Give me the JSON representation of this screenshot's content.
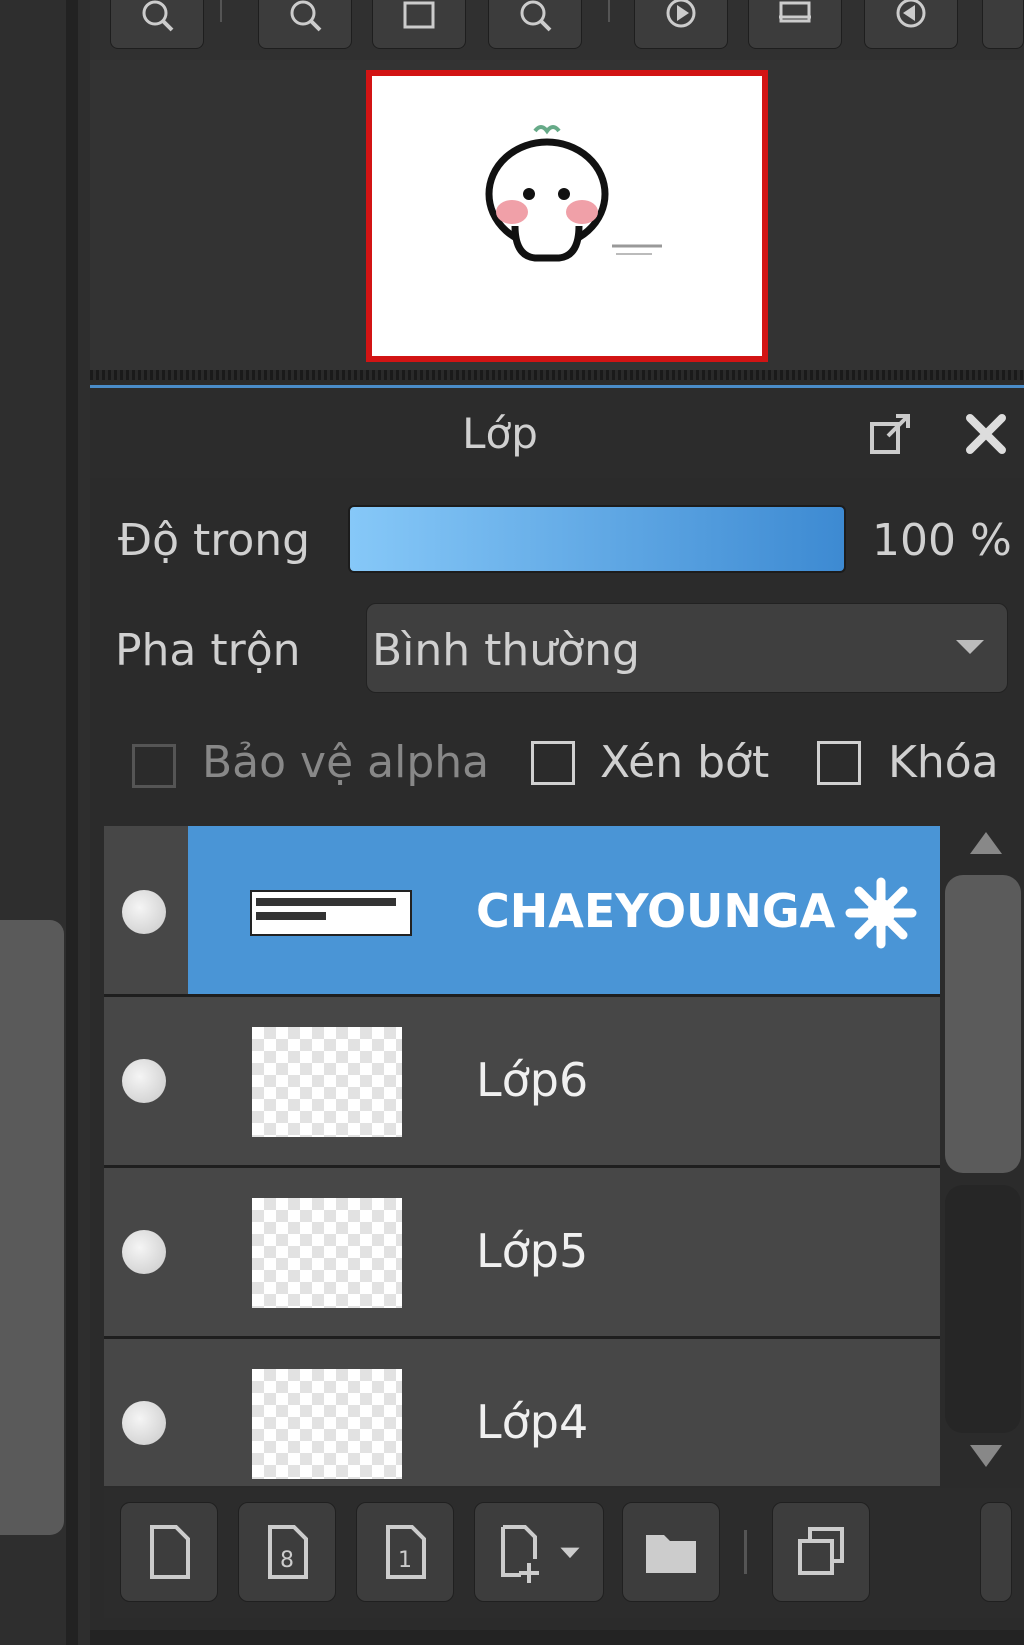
{
  "layer_panel": {
    "title": "Lớp",
    "opacity_label": "Độ trong",
    "opacity_value": "100 %",
    "opacity_fraction": 1.0,
    "blend_label": "Pha trộn",
    "blend_value": "Bình thường",
    "protect_alpha_label": "Bảo vệ alpha",
    "clipping_label": "Xén bớt",
    "lock_label": "Khóa",
    "layers": [
      {
        "name": "CHAEYOUNGA",
        "selected": true
      },
      {
        "name": "Lớp6",
        "selected": false
      },
      {
        "name": "Lớp5",
        "selected": false
      },
      {
        "name": "Lớp4",
        "selected": false
      }
    ]
  },
  "icons": {
    "nav_toolbar": [
      "zoom-in-icon",
      "zoom-out-icon",
      "fit-to-screen-icon",
      "actual-size-icon",
      "rotate-right-icon",
      "flip-horizontal-icon",
      "rotate-left-icon"
    ],
    "layer_header": [
      "popout-icon",
      "close-icon"
    ],
    "bottom_toolbar": [
      "new-layer-icon",
      "new-8bit-layer-icon",
      "new-1bit-layer-icon",
      "new-layer-menu-icon",
      "new-folder-icon",
      "duplicate-layer-icon"
    ]
  },
  "colors": {
    "accent": "#4a95d6",
    "navigator_frame": "#d21414",
    "panel_bg": "#2c2c2c"
  }
}
